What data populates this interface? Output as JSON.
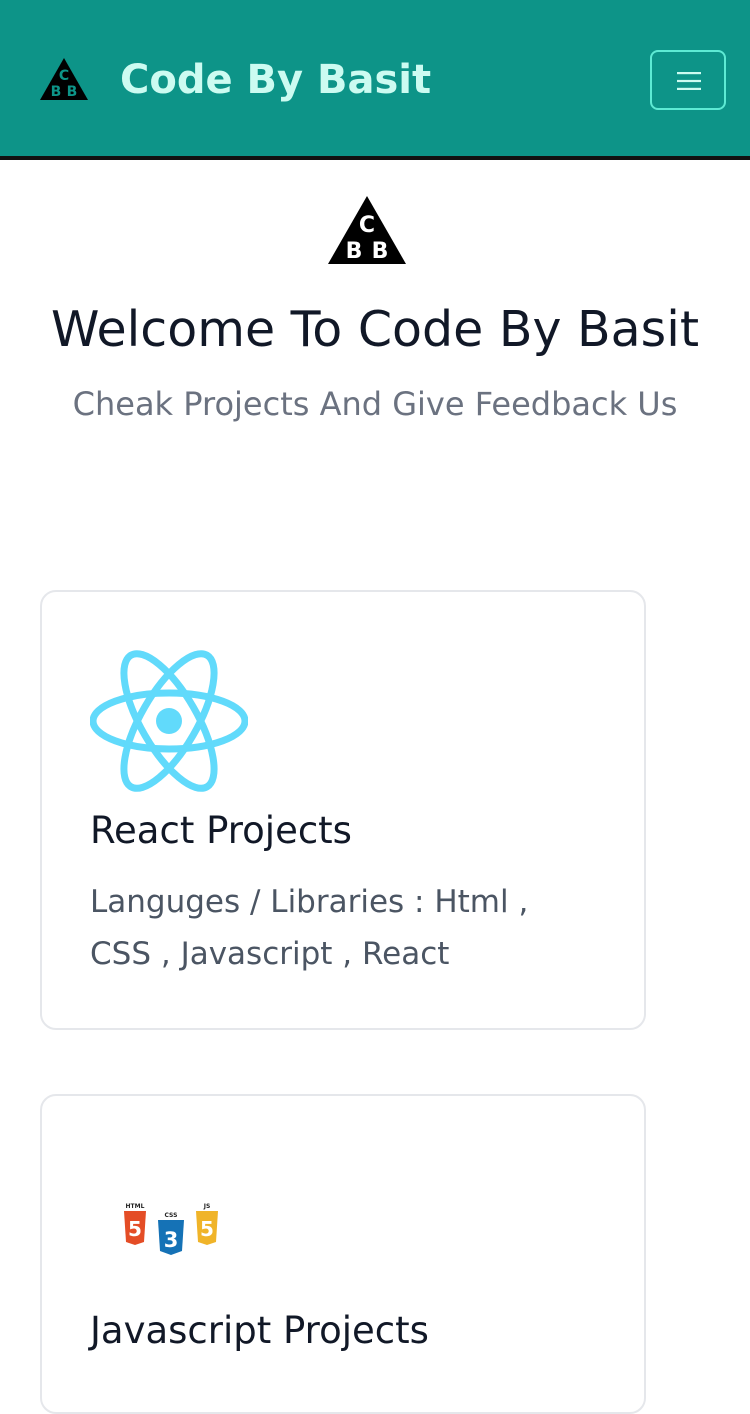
{
  "navbar": {
    "brand": "Code By Basit",
    "logo_icon": "cbb-logo-icon",
    "menu_icon": "hamburger-menu-icon",
    "background": "#0d9488",
    "brand_color": "#ccfbf1"
  },
  "hero": {
    "title": "Welcome To Code By Basit",
    "subtitle": "Cheak Projects And Give Feedback Us"
  },
  "projects": [
    {
      "title": "React Projects",
      "description": "Languges / Libraries : Html , CSS , Javascript , React",
      "icon": "react-icon",
      "icon_color": "#61dafb"
    },
    {
      "title": "Javascript Projects",
      "icon": "html-css-js-icon",
      "icon_labels": [
        "HTML",
        "CSS",
        "JS"
      ],
      "icon_colors": [
        "#e44d26",
        "#1572b6",
        "#f0b429"
      ]
    }
  ]
}
